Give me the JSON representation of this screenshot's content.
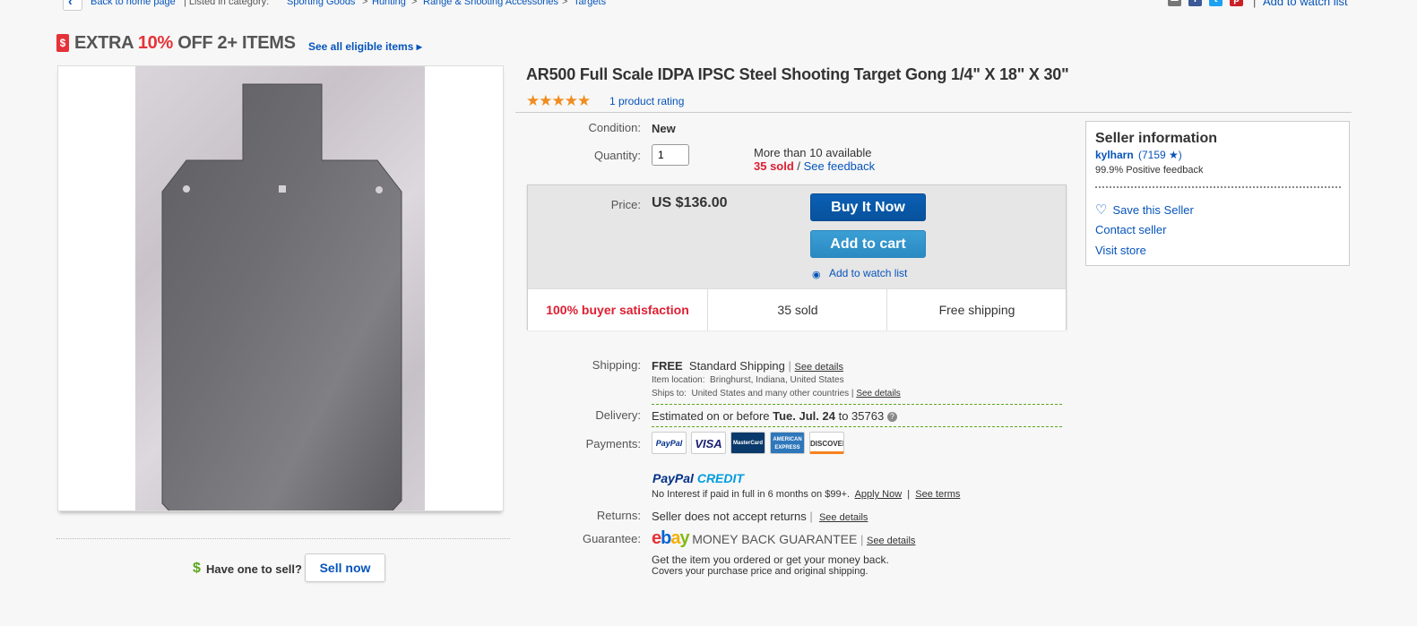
{
  "breadcrumb": {
    "back_label": "Back to home page",
    "listed_in": "| Listed in category:",
    "items": [
      "Sporting Goods",
      "Hunting",
      "Range & Shooting Accessories",
      "Targets"
    ],
    "separator": ">",
    "watch_label": "Add to watch list",
    "share_sep": "|"
  },
  "promo": {
    "tag": "$",
    "prefix": "EXTRA ",
    "highlight": "10%",
    "suffix": " OFF 2+ ITEMS",
    "link": "See all eligible items ▸"
  },
  "item": {
    "title": "AR500 Full Scale IDPA IPSC Steel Shooting Target Gong 1/4\" X 18\" X 30\"",
    "stars": "★★★★★",
    "rating_link": "1 product rating",
    "condition_label": "Condition:",
    "condition_value": "New",
    "quantity_label": "Quantity:",
    "quantity_value": "1",
    "availability": "More than 10 available",
    "sold_count": "35 sold",
    "sold_sep": " / ",
    "feedback_link": "See feedback"
  },
  "purchase": {
    "price_label": "Price:",
    "price_value": "US $136.00",
    "buy_now": "Buy It Now",
    "add_to_cart": "Add to cart",
    "watch_link": "Add to watch list",
    "stats": [
      "100% buyer satisfaction",
      "35 sold",
      "Free shipping"
    ]
  },
  "shipping": {
    "label": "Shipping:",
    "free": "FREE",
    "method": "Standard Shipping",
    "sep": "|",
    "details_link": "See details",
    "location_label": "Item location:",
    "location": "Bringhurst, Indiana, United States",
    "ships_to_label": "Ships to:",
    "ships_to": "United States and many other countries",
    "ships_details": "See details"
  },
  "delivery": {
    "label": "Delivery:",
    "prefix": "Estimated on or before ",
    "date": "Tue. Jul. 24",
    "suffix": " to 35763",
    "help": "?"
  },
  "payments": {
    "label": "Payments:",
    "methods": [
      "PayPal",
      "VISA",
      "MasterCard",
      "AMERICAN EXPRESS",
      "DISCOVER"
    ],
    "credit_logo_a": "PayPal",
    "credit_logo_b": " CREDIT",
    "credit_text": "No Interest if paid in full in 6 months on $99+.",
    "apply_link": "Apply Now",
    "sep": "|",
    "terms_link": "See terms"
  },
  "returns": {
    "label": "Returns:",
    "value": "Seller does not accept returns",
    "sep": "|",
    "details_link": "See details"
  },
  "guarantee": {
    "label": "Guarantee:",
    "logo": "ebay",
    "text": "MONEY BACK GUARANTEE",
    "sep": "|",
    "details_link": "See details",
    "line1": "Get the item you ordered or get your money back.",
    "line2": "Covers your purchase price and original shipping."
  },
  "seller": {
    "title": "Seller information",
    "name": "kylharn",
    "score": "(7159 ★)",
    "feedback": "99.9% Positive feedback",
    "save": "Save this Seller",
    "contact": "Contact seller",
    "store": "Visit store"
  },
  "sell": {
    "dollar": "$",
    "text": "Have one to sell?",
    "button": "Sell now"
  },
  "colors": {
    "link": "#0654ba",
    "buy_button": "#07529d",
    "cart_button": "#2a8ac3",
    "alert_red": "#e53238",
    "star": "#f18c1e"
  }
}
